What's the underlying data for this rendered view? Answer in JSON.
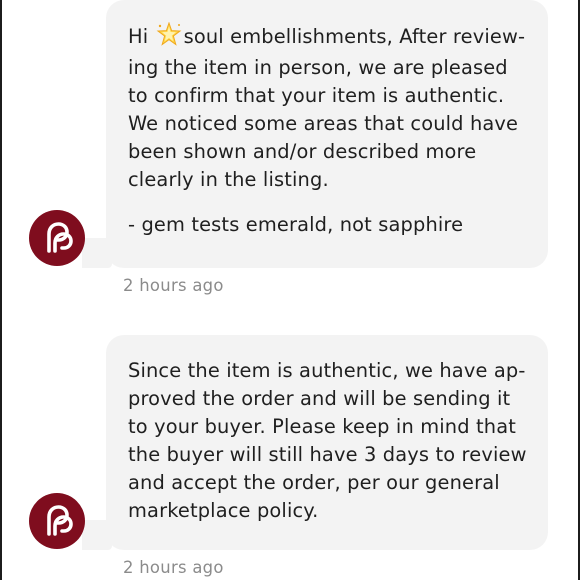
{
  "messages": [
    {
      "lines": {
        "line1_before": "Hi ",
        "line1_after": "soul embellishments, After review-",
        "line2": "ing the item in person, we are pleased",
        "line3": "to confirm that your item is authentic.",
        "line4": "We noticed some areas that could have",
        "line5": "been shown and/or described more",
        "line6": "clearly in the listing.",
        "line7": "- gem tests emerald, not sapphire"
      },
      "timestamp": "2 hours ago",
      "avatar_icon": "poshmark-logo-icon",
      "sparkle_icon": "sparkle-star-icon"
    },
    {
      "lines": {
        "line1": "Since the item is authentic, we have ap-",
        "line2": "proved the order and will be sending it",
        "line3": "to your buyer. Please keep in mind that",
        "line4": "the buyer will still have 3 days to review",
        "line5": "and accept the order, per our general",
        "line6": "marketplace policy."
      },
      "timestamp": "2 hours ago",
      "avatar_icon": "poshmark-logo-icon"
    }
  ],
  "colors": {
    "avatar_bg": "#7f0d1e",
    "bubble_bg": "#f3f3f3",
    "text": "#1f1f1f",
    "timestamp": "#8b8b8b"
  }
}
